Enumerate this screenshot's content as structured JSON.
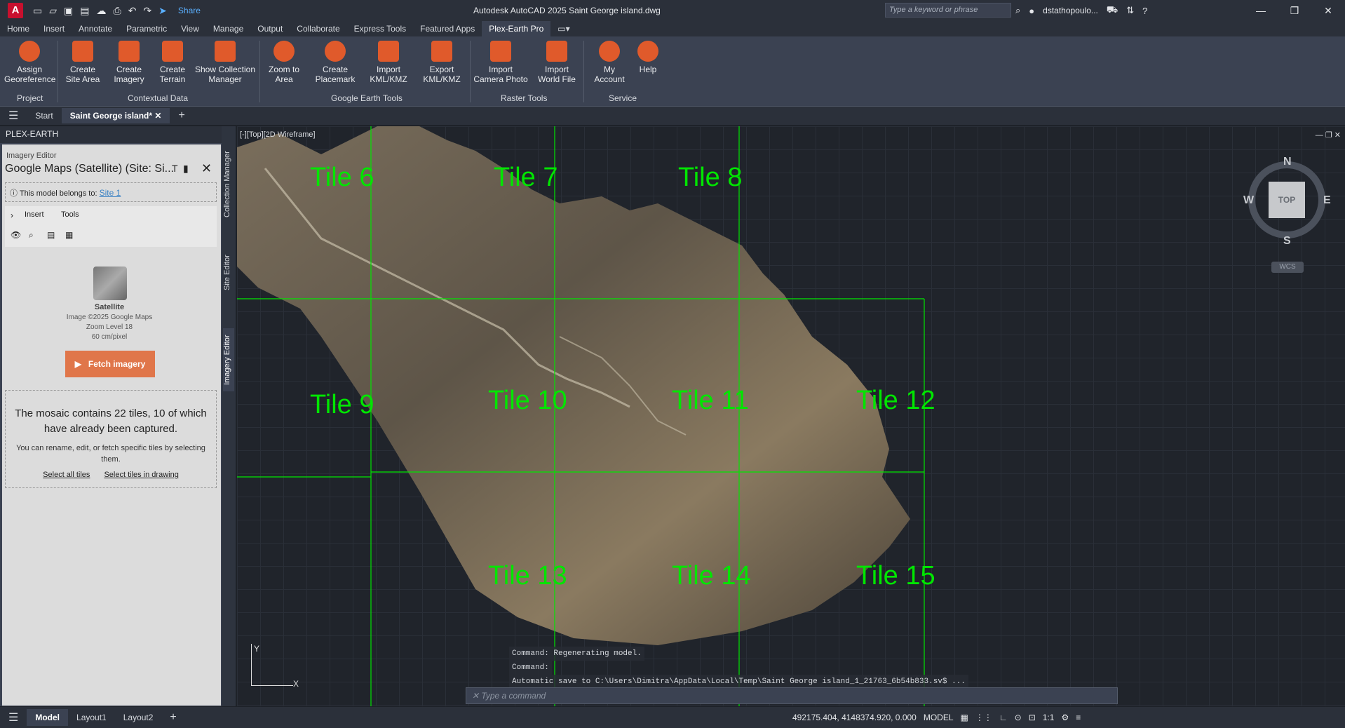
{
  "app": {
    "title": "Autodesk AutoCAD 2025   Saint George island.dwg",
    "logo": "A",
    "share": "Share",
    "search_placeholder": "Type a keyword or phrase",
    "user": "dstathopoulo..."
  },
  "menu_tabs": [
    "Home",
    "Insert",
    "Annotate",
    "Parametric",
    "View",
    "Manage",
    "Output",
    "Collaborate",
    "Express Tools",
    "Featured Apps",
    "Plex-Earth Pro"
  ],
  "ribbon": {
    "buttons": [
      {
        "label": "Assign\nGeoreference",
        "icon": "georeference-icon"
      },
      {
        "label": "Create\nSite Area",
        "icon": "site-area-icon"
      },
      {
        "label": "Create\nImagery",
        "icon": "imagery-icon"
      },
      {
        "label": "Create\nTerrain",
        "icon": "terrain-icon"
      },
      {
        "label": "Show Collection\nManager",
        "icon": "collection-manager-icon"
      },
      {
        "label": "Zoom to\nArea",
        "icon": "zoom-area-icon"
      },
      {
        "label": "Create\nPlacemark",
        "icon": "placemark-icon"
      },
      {
        "label": "Import\nKML/KMZ",
        "icon": "import-kml-icon"
      },
      {
        "label": "Export\nKML/KMZ",
        "icon": "export-kml-icon"
      },
      {
        "label": "Import\nCamera Photo",
        "icon": "camera-photo-icon"
      },
      {
        "label": "Import\nWorld File",
        "icon": "world-file-icon"
      },
      {
        "label": "My\nAccount",
        "icon": "account-icon"
      },
      {
        "label": "Help",
        "icon": "help-icon"
      }
    ],
    "panels": [
      "Project",
      "Contextual Data",
      "Google Earth Tools",
      "Raster Tools",
      "Service"
    ]
  },
  "doc_tabs": {
    "start": "Start",
    "active": "Saint George island*"
  },
  "left_panel": {
    "title": "PLEX-EARTH",
    "section": "Imagery Editor",
    "provider": "Google Maps (Satellite) (Site: Si...",
    "belongs_label": "This model belongs to:",
    "belongs_link": "Site 1",
    "toolbar": {
      "insert": "Insert",
      "tools": "Tools"
    },
    "thumb_title": "Satellite",
    "thumb_lines": [
      "Image ©2025 Google Maps",
      "Zoom Level 18",
      "60 cm/pixel"
    ],
    "fetch_button": "Fetch imagery",
    "mosaic_text": "The mosaic contains 22 tiles, 10 of which have already been captured.",
    "hint_text": "You can rename, edit, or fetch specific tiles by selecting them.",
    "link_select_all": "Select all tiles",
    "link_select_drawing": "Select tiles in drawing"
  },
  "vertical_tabs": [
    "Collection Manager",
    "Site Editor",
    "Imagery Editor"
  ],
  "viewport": {
    "label": "[-][Top][2D Wireframe]",
    "tiles": [
      "Tile 6",
      "Tile 7",
      "Tile 8",
      "Tile 9",
      "Tile 10",
      "Tile 11",
      "Tile 12",
      "Tile 13",
      "Tile 14",
      "Tile 15"
    ],
    "viewcube": {
      "n": "N",
      "s": "S",
      "e": "E",
      "w": "W",
      "top": "TOP",
      "wcs": "WCS"
    },
    "ucs": {
      "x": "X",
      "y": "Y"
    }
  },
  "command": {
    "lines": [
      "Command: Regenerating model.",
      "Command:",
      "Automatic save to C:\\Users\\Dimitra\\AppData\\Local\\Temp\\Saint George island_1_21763_6b54b833.sv$ ..."
    ],
    "placeholder": "Type a command"
  },
  "status": {
    "model": "Model",
    "layout1": "Layout1",
    "layout2": "Layout2",
    "coords": "492175.404, 4148374.920, 0.000",
    "mode": "MODEL",
    "scale": "1:1"
  }
}
